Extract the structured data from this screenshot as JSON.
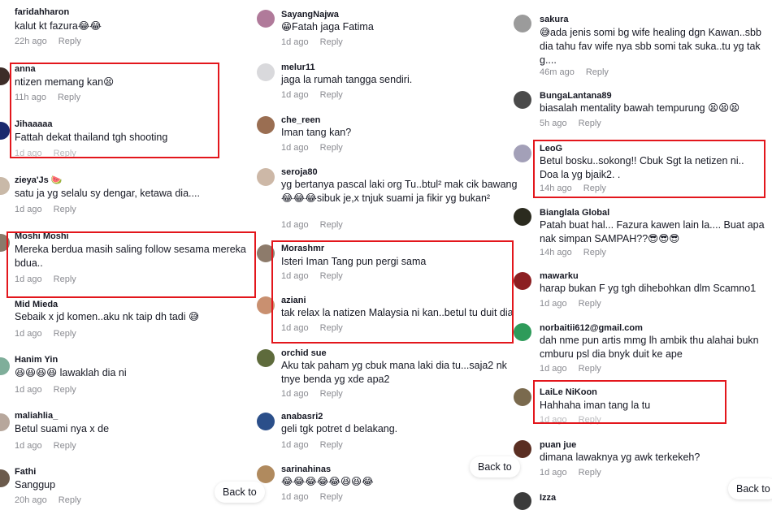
{
  "meta_labels": {
    "reply": "Reply"
  },
  "back_to_label": "Back to",
  "columns": [
    {
      "comments": [
        {
          "user": "faridahharon",
          "text": "kalut kt fazura😂😂",
          "time": "22h ago"
        },
        {
          "user": "anna",
          "text": "ntizen memang kan😫",
          "time": "11h ago"
        },
        {
          "user": "Jihaaaaa",
          "text": "Fattah dekat thailand tgh shooting",
          "time": "1d ago"
        },
        {
          "user": "zieya'Js 🍉",
          "text": "satu ja yg selalu sy dengar, ketawa dia....",
          "time": "1d ago"
        },
        {
          "user": "Moshi Moshi",
          "text": "Mereka berdua masih saling follow sesama mereka bdua..",
          "time": "1d ago"
        },
        {
          "user": "Mid Mieda",
          "text": "Sebaik x jd komen..aku nk taip dh tadi 😅",
          "time": "1d ago"
        },
        {
          "user": "Hanim Yin",
          "text": "😆😆😆😆 lawaklah dia ni",
          "time": "1d ago"
        },
        {
          "user": "maliahlia_",
          "text": "Betul suami nya x de",
          "time": "1d ago"
        },
        {
          "user": "Fathi",
          "text": "Sanggup",
          "time": "20h ago"
        }
      ]
    },
    {
      "comments": [
        {
          "user": "SayangNajwa",
          "text": "😁Fatah jaga Fatima",
          "time": "1d ago"
        },
        {
          "user": "melur11",
          "text": "jaga la rumah tangga sendiri.",
          "time": "1d ago"
        },
        {
          "user": "che_reen",
          "text": "Iman tang kan?",
          "time": "1d ago"
        },
        {
          "user": "seroja80",
          "text": "yg bertanya pascal laki org Tu..btul² mak cik bawang😂😂😂sibuk je,x tnjuk suami ja fikir yg bukan²",
          "time": "1d ago"
        },
        {
          "user": "Morashmr",
          "text": "Isteri Iman Tang pun pergi sama",
          "time": "1d ago"
        },
        {
          "user": "aziani",
          "text": "tak relax la natizen Malaysia ni kan..betul tu duit dia",
          "time": "1d ago"
        },
        {
          "user": "orchid sue",
          "text": "Aku tak paham yg cbuk mana laki dia tu...saja2 nk tnye benda yg xde apa2",
          "time": "1d ago"
        },
        {
          "user": "anabasri2",
          "text": "geli tgk potret d belakang.",
          "time": "1d ago"
        },
        {
          "user": "sarinahinas",
          "text": "😂😂😂😂😂😆😆😂",
          "time": "1d ago"
        }
      ]
    },
    {
      "comments": [
        {
          "user": "sakura",
          "text": "😅ada jenis somi bg wife healing dgn Kawan..sbb dia tahu fav wife nya sbb somi tak suka..tu yg tak g....",
          "time": "46m ago"
        },
        {
          "user": "BungaLantana89",
          "text": "biasalah mentality bawah tempurung 😫😫😫",
          "time": "5h ago"
        },
        {
          "user": "LeoG",
          "text": "Betul bosku..sokong!! Cbuk Sgt la netizen ni.. Doa la yg bjaik2. .",
          "time": "14h ago"
        },
        {
          "user": "Bianglala Global",
          "text": "Patah buat hal... Fazura kawen lain la.... Buat apa nak simpan SAMPAH??😎😎😎",
          "time": "14h ago"
        },
        {
          "user": "mawarku",
          "text": "harap bukan F yg tgh dihebohkan dlm Scamno1",
          "time": "1d ago"
        },
        {
          "user": "norbaitii612@gmail.com",
          "text": "dah nme pun artis mmg lh ambik thu alahai bukn cmburu psl dia bnyk duit ke ape",
          "time": "1d ago"
        },
        {
          "user": "LaiLe NiKoon",
          "text": "Hahhaha iman tang la tu",
          "time": "1d ago"
        },
        {
          "user": "puan jue",
          "text": "dimana lawaknya yg awk terkekeh?",
          "time": "1d ago"
        },
        {
          "user": "Izza",
          "text": "",
          "time": ""
        }
      ]
    }
  ],
  "colors": {
    "highlight": "#e3161c",
    "meta": "#8a8b91",
    "text": "#161823"
  }
}
